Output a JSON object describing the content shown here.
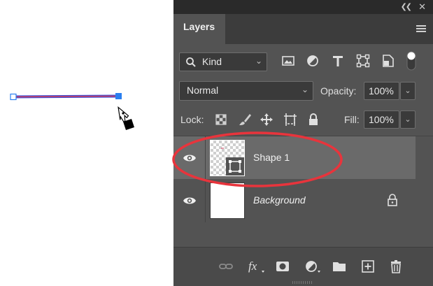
{
  "window": {
    "collapse_icon": "double-chevron-left-icon",
    "close_icon": "close-icon"
  },
  "panel": {
    "tab_label": "Layers",
    "menu_icon": "hamburger-menu-icon"
  },
  "filter": {
    "kind_label": "Kind",
    "icons": [
      "image-filter-icon",
      "adjustment-filter-icon",
      "type-filter-icon",
      "shape-filter-icon",
      "smart-object-filter-icon",
      "filter-toggle-icon"
    ]
  },
  "blend": {
    "mode": "Normal",
    "opacity_label": "Opacity:",
    "opacity_value": "100%"
  },
  "lock": {
    "label": "Lock:",
    "icons": [
      "lock-transparent-pixels-icon",
      "lock-image-pixels-icon",
      "lock-position-icon",
      "lock-artboard-icon",
      "lock-all-icon"
    ],
    "fill_label": "Fill:",
    "fill_value": "100%"
  },
  "layers": [
    {
      "name": "Shape 1",
      "visible": true,
      "selected": true,
      "italic": false,
      "locked": false
    },
    {
      "name": "Background",
      "visible": true,
      "selected": false,
      "italic": true,
      "locked": true
    }
  ],
  "bottom_toolbar": {
    "icons": [
      "link-layers-icon",
      "fx-icon",
      "layer-mask-icon",
      "adjustment-layer-icon",
      "group-folder-icon",
      "new-layer-icon",
      "delete-trash-icon"
    ]
  },
  "colors": {
    "panel_bg": "#535353",
    "selected_row": "#6a6a6a",
    "annotation_red": "#e8343c",
    "path_stroke": "#4a5ad8",
    "anchor_blue": "#2a7ff0"
  }
}
